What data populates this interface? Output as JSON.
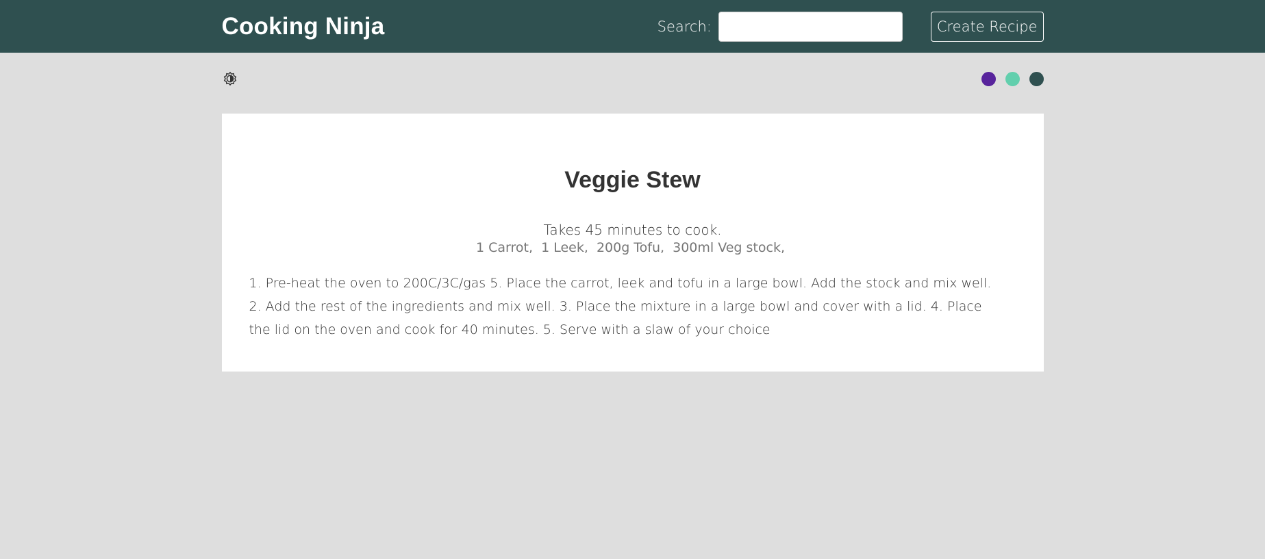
{
  "navbar": {
    "brand": "Cooking Ninja",
    "search_label": "Search:",
    "search_value": "",
    "create_label": "Create Recipe",
    "bg_color": "#2f5050"
  },
  "toolbar": {
    "mode_icon": "brightness-contrast-icon",
    "swatches": [
      {
        "color": "#58249c",
        "name": "purple"
      },
      {
        "color": "#62cfad",
        "name": "teal"
      },
      {
        "color": "#2f5050",
        "name": "dark-green"
      }
    ]
  },
  "recipe": {
    "title": "Veggie Stew",
    "cooking_time": "Takes 45 minutes to cook.",
    "ingredients": [
      "1 Carrot,",
      "1 Leek,",
      "200g Tofu,",
      "300ml Veg stock,"
    ],
    "method": "1. Pre-heat the oven to 200C/3C/gas 5. Place the carrot, leek and tofu in a large bowl. Add the stock and mix well. 2. Add the rest of the ingredients and mix well. 3. Place the mixture in a large bowl and cover with a lid. 4. Place the lid on the oven and cook for 40 minutes. 5. Serve with a slaw of your choice"
  }
}
